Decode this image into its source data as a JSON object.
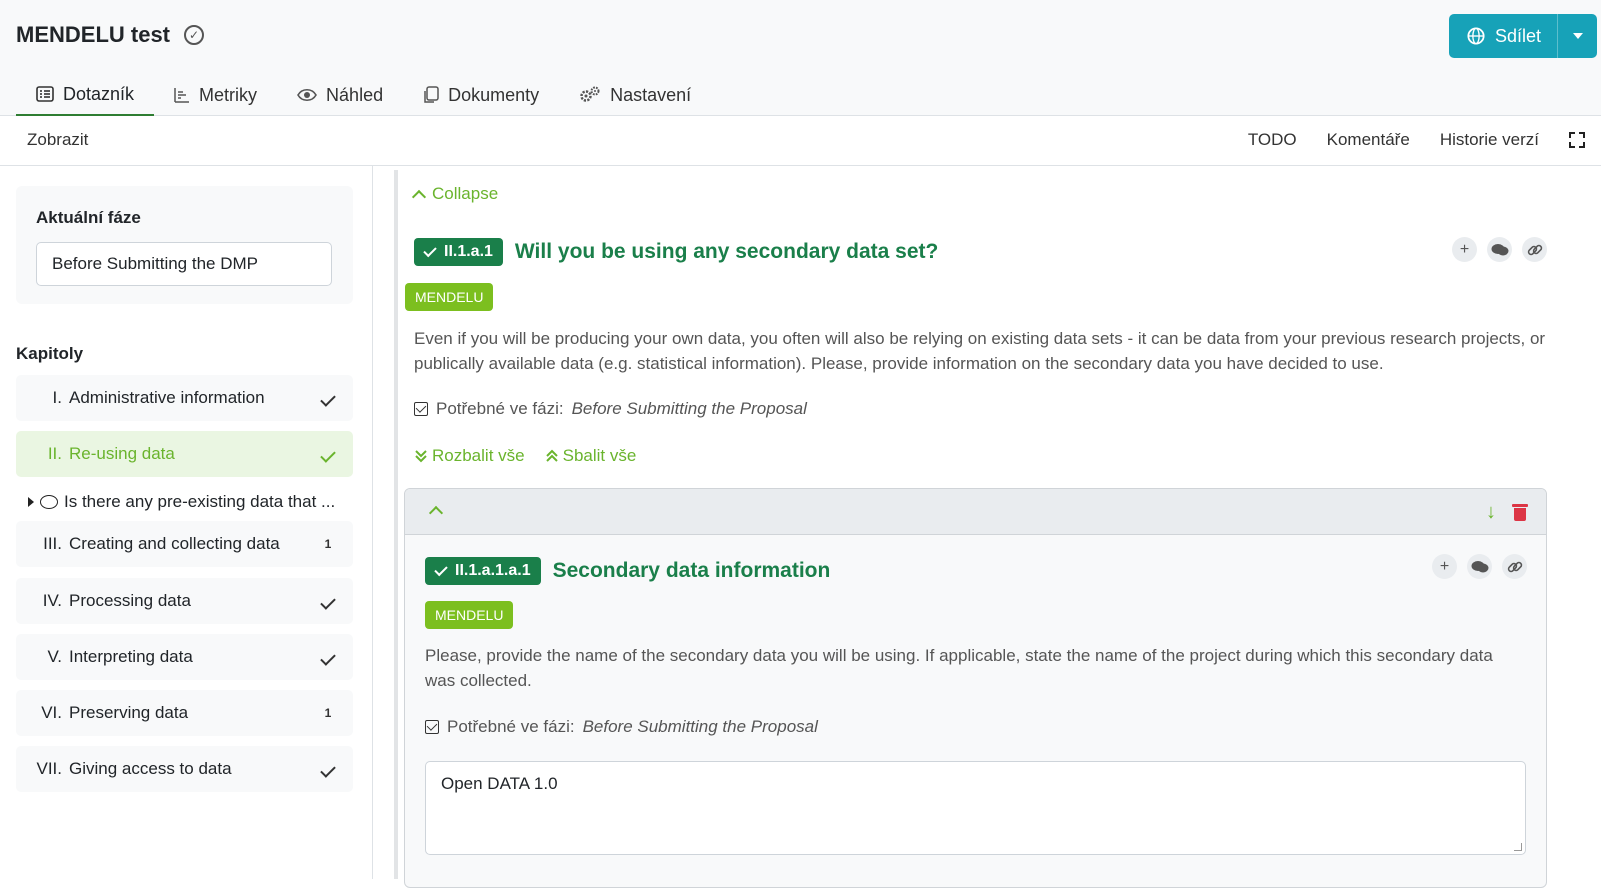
{
  "app": {
    "title": "MENDELU test"
  },
  "share": {
    "label": "Sdílet"
  },
  "tabs": [
    {
      "label": "Dotazník",
      "icon": "list-icon"
    },
    {
      "label": "Metriky",
      "icon": "chart-icon"
    },
    {
      "label": "Náhled",
      "icon": "eye-icon"
    },
    {
      "label": "Dokumenty",
      "icon": "copy-icon"
    },
    {
      "label": "Nastavení",
      "icon": "gears-icon"
    }
  ],
  "toolbar": {
    "view": "Zobrazit",
    "todo": "TODO",
    "comments": "Komentáře",
    "history": "Historie verzí"
  },
  "sidebar": {
    "phase_label": "Aktuální fáze",
    "phase_value": "Before Submitting the DMP",
    "chapters_title": "Kapitoly",
    "chapters": [
      {
        "num": "I.",
        "label": "Administrative information",
        "status": "done"
      },
      {
        "num": "II.",
        "label": "Re-using data",
        "status": "done"
      },
      {
        "num": "III.",
        "label": "Creating and collecting data",
        "status": "1"
      },
      {
        "num": "IV.",
        "label": "Processing data",
        "status": "done"
      },
      {
        "num": "V.",
        "label": "Interpreting data",
        "status": "done"
      },
      {
        "num": "VI.",
        "label": "Preserving data",
        "status": "1"
      },
      {
        "num": "VII.",
        "label": "Giving access to data",
        "status": "done"
      }
    ],
    "subitem": "Is there any pre-existing data that ..."
  },
  "main": {
    "collapse": "Collapse",
    "question": {
      "badge": "II.1.a.1",
      "title": "Will you be using any secondary data set?",
      "tag": "MENDELU",
      "description": "Even if you will be producing your own data, you often will also be relying on existing data sets - it can be data from your previous research projects, or publically available data (e.g. statistical information). Please, provide information on the secondary data you have decided to use.",
      "phase_prefix": "Potřebné ve fázi:",
      "phase_value": "Before Submitting the Proposal"
    },
    "expand_all": "Rozbalit vše",
    "collapse_all": "Sbalit vše",
    "item": {
      "badge": "II.1.a.1.a.1",
      "title": "Secondary data information",
      "tag": "MENDELU",
      "description": "Please, provide the name of the secondary data you will be using. If applicable, state the name of the project during which this secondary data was collected.",
      "phase_prefix": "Potřebné ve fázi:",
      "phase_value": "Before Submitting the Proposal",
      "answer": "Open DATA 1.0"
    }
  },
  "colors": {
    "accent_green": "#1a7f4a",
    "light_green": "#6ab42d",
    "share_blue": "#17a2b8",
    "danger": "#dc3545"
  }
}
